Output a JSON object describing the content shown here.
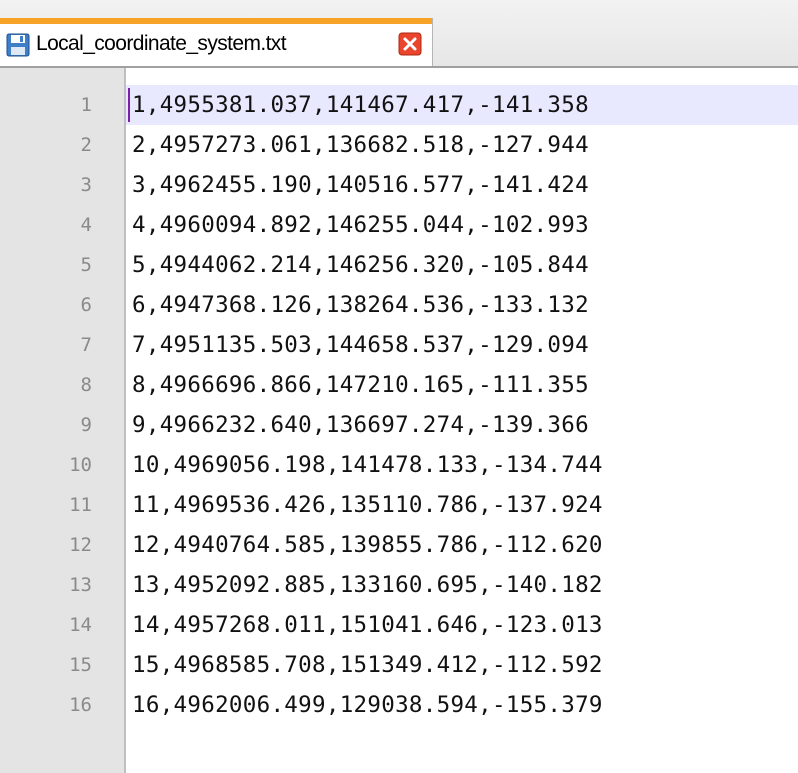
{
  "tab": {
    "title": "Local_coordinate_system.txt",
    "icon": "save-icon",
    "close_icon": "close-icon",
    "accent_color": "#f6a328",
    "close_color": "#e8452c"
  },
  "editor": {
    "current_line": 1,
    "lines": [
      {
        "number": "1",
        "text": "1,4955381.037,141467.417,-141.358"
      },
      {
        "number": "2",
        "text": "2,4957273.061,136682.518,-127.944"
      },
      {
        "number": "3",
        "text": "3,4962455.190,140516.577,-141.424"
      },
      {
        "number": "4",
        "text": "4,4960094.892,146255.044,-102.993"
      },
      {
        "number": "5",
        "text": "5,4944062.214,146256.320,-105.844"
      },
      {
        "number": "6",
        "text": "6,4947368.126,138264.536,-133.132"
      },
      {
        "number": "7",
        "text": "7,4951135.503,144658.537,-129.094"
      },
      {
        "number": "8",
        "text": "8,4966696.866,147210.165,-111.355"
      },
      {
        "number": "9",
        "text": "9,4966232.640,136697.274,-139.366"
      },
      {
        "number": "10",
        "text": "10,4969056.198,141478.133,-134.744"
      },
      {
        "number": "11",
        "text": "11,4969536.426,135110.786,-137.924"
      },
      {
        "number": "12",
        "text": "12,4940764.585,139855.786,-112.620"
      },
      {
        "number": "13",
        "text": "13,4952092.885,133160.695,-140.182"
      },
      {
        "number": "14",
        "text": "14,4957268.011,151041.646,-123.013"
      },
      {
        "number": "15",
        "text": "15,4968585.708,151349.412,-112.592"
      },
      {
        "number": "16",
        "text": "16,4962006.499,129038.594,-155.379"
      }
    ]
  }
}
